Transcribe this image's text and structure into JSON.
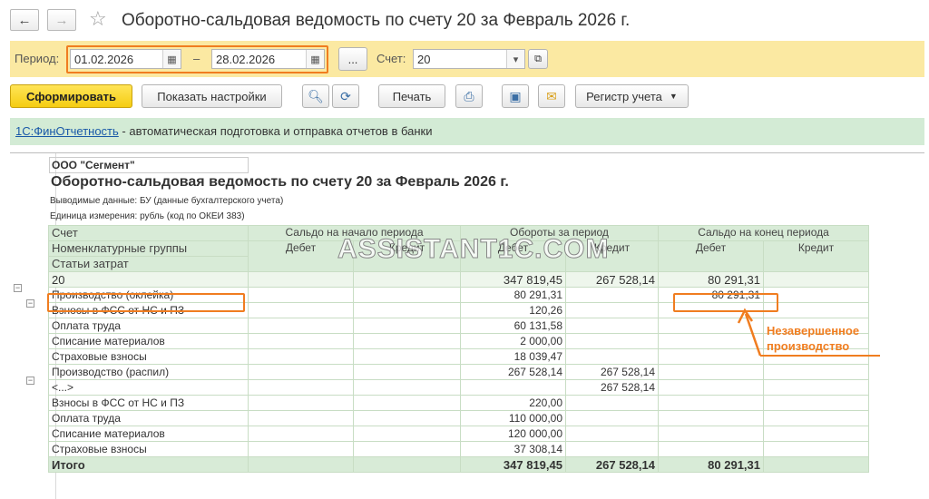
{
  "window": {
    "title": "Оборотно-сальдовая ведомость по счету 20 за Февраль 2026 г."
  },
  "nav": {
    "back": "←",
    "forward": "→",
    "favorite": "☆"
  },
  "period": {
    "label": "Период:",
    "from": "01.02.2026",
    "dash": "–",
    "to": "28.02.2026",
    "more": "...",
    "account_label": "Счет:",
    "account_value": "20"
  },
  "toolbar": {
    "generate": "Сформировать",
    "settings": "Показать настройки",
    "print": "Печать",
    "register": "Регистр учета"
  },
  "banner": {
    "link": "1С:ФинОтчетность",
    "text": " - автоматическая подготовка и отправка отчетов в банки"
  },
  "report": {
    "org": "ООО \"Сегмент\"",
    "title": "Оборотно-сальдовая ведомость по счету 20 за Февраль 2026 г.",
    "output": "Выводимые данные:  БУ (данные бухгалтерского учета)",
    "unit": "Единица измерения:  рубль (код по ОКЕИ 383)",
    "headers": {
      "account": "Счет",
      "nomenclature": "Номенклатурные группы",
      "cost_items": "Статьи затрат",
      "opening": "Сальдо на начало периода",
      "turnover": "Обороты за период",
      "closing": "Сальдо на конец периода",
      "debit": "Дебет",
      "credit": "Кредит"
    },
    "rows": {
      "acc": {
        "name": "20",
        "od": "",
        "oc": "",
        "td": "347 819,45",
        "tc": "267 528,14",
        "cd": "80 291,31",
        "cc": ""
      },
      "g1": {
        "name": "Производство (оклейка)",
        "od": "",
        "oc": "",
        "td": "80 291,31",
        "tc": "",
        "cd": "80 291,31",
        "cc": ""
      },
      "g1r1": {
        "name": "Взносы в ФСС от НС и ПЗ",
        "td": "120,26"
      },
      "g1r2": {
        "name": "Оплата труда",
        "td": "60 131,58"
      },
      "g1r3": {
        "name": "Списание материалов",
        "td": "2 000,00"
      },
      "g1r4": {
        "name": "Страховые взносы",
        "td": "18 039,47"
      },
      "g2": {
        "name": "Производство (распил)",
        "td": "267 528,14",
        "tc": "267 528,14"
      },
      "g2r0": {
        "name": "<...>",
        "tc": "267 528,14"
      },
      "g2r1": {
        "name": "Взносы в ФСС от НС и ПЗ",
        "td": "220,00"
      },
      "g2r2": {
        "name": "Оплата труда",
        "td": "110 000,00"
      },
      "g2r3": {
        "name": "Списание материалов",
        "td": "120 000,00"
      },
      "g2r4": {
        "name": "Страховые взносы",
        "td": "37 308,14"
      },
      "total": {
        "name": "Итого",
        "td": "347 819,45",
        "tc": "267 528,14",
        "cd": "80 291,31"
      }
    }
  },
  "annotation": {
    "line1": "Незавершенное",
    "line2": "производство"
  },
  "watermark": "ASSISTANT1C.COM",
  "colors": {
    "accent": "#f07d20",
    "header_bg": "#d8ebd7",
    "period_bar": "#fbe9a2",
    "banner_bg": "#d3ebd5"
  }
}
